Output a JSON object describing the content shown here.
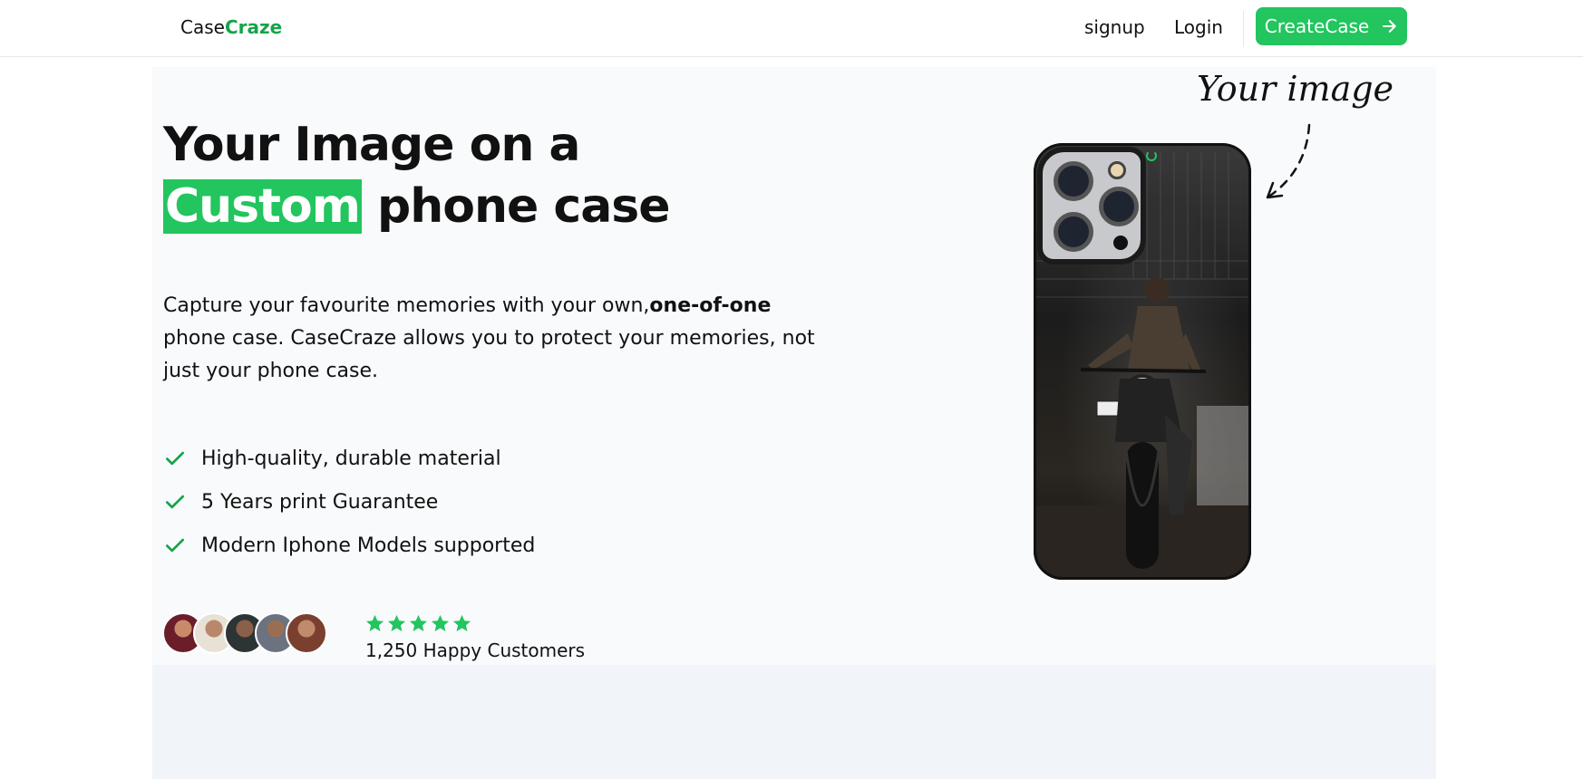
{
  "nav": {
    "logo_prefix": "Case",
    "logo_accent": "Craze",
    "signup_label": "signup",
    "login_label": "Login",
    "cta_label": "CreateCase"
  },
  "hero": {
    "title_line1": "Your Image on a",
    "title_highlight": "Custom",
    "title_line2_rest": " phone case",
    "desc_part1": "Capture your favourite memories with your own,",
    "desc_bold": "one-of-one",
    "desc_part2": " phone case. CaseCraze allows you to protect your memories, not just your phone case.",
    "features": [
      "High-quality, durable material",
      "5 Years print Guarantee",
      "Modern Iphone Models supported"
    ],
    "rating_stars": 5,
    "customers_text": "1,250 Happy Customers"
  },
  "phone": {
    "annotation": "Your image"
  },
  "colors": {
    "accent": "#22c55e",
    "accent_text": "#16a34a"
  }
}
